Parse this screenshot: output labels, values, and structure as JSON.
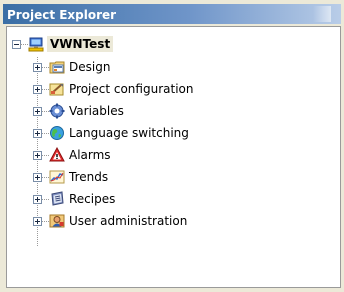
{
  "window": {
    "title": "Project Explorer"
  },
  "tree": {
    "root": {
      "label": "VWNTest",
      "icon": "project-computer-icon",
      "expanded": true
    },
    "items": [
      {
        "label": "Design",
        "icon": "design-icon",
        "expanded": false
      },
      {
        "label": "Project configuration",
        "icon": "project-configuration-icon",
        "expanded": false
      },
      {
        "label": "Variables",
        "icon": "variables-gear-icon",
        "expanded": false
      },
      {
        "label": "Language switching",
        "icon": "globe-icon",
        "expanded": false
      },
      {
        "label": "Alarms",
        "icon": "alarm-warning-icon",
        "expanded": false
      },
      {
        "label": "Trends",
        "icon": "trends-chart-icon",
        "expanded": false
      },
      {
        "label": "Recipes",
        "icon": "recipes-icon",
        "expanded": false
      },
      {
        "label": "User administration",
        "icon": "user-administration-icon",
        "expanded": false
      }
    ]
  },
  "colors": {
    "titlebar_start": "#3a6ea5",
    "titlebar_end": "#b9cde8",
    "panel_background": "#ffffff",
    "window_background": "#ece9d8"
  }
}
